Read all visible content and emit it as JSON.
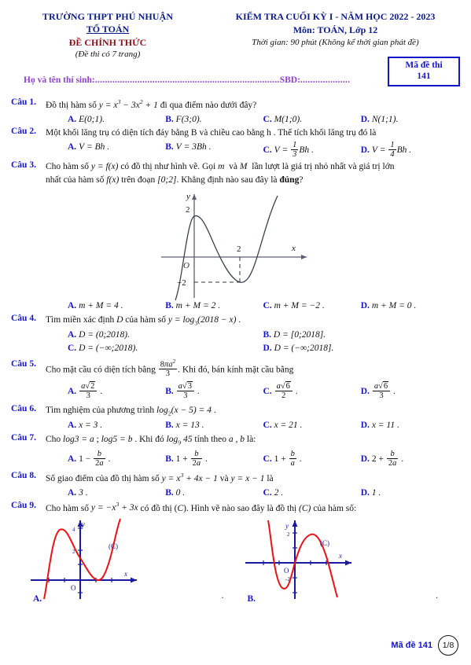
{
  "header": {
    "school": "TRƯỜNG THPT PHÚ NHUẬN",
    "dept": "TỔ TOÁN",
    "official": "ĐỀ CHÍNH THỨC",
    "pages_note": "(Đề thi có 7 trang)",
    "exam_title": "KIỂM TRA CUỐI KỲ I - NĂM HỌC 2022 - 2023",
    "subject": "Môn: TOÁN, Lớp 12",
    "duration": "Thời gian: 90 phút (Không kể thời gian phát đề)",
    "code_label": "Mã đề thi",
    "code_value": "141",
    "name_label": "Họ và tên thí sinh:",
    "name_dots": "..........................................................................",
    "sbd_label": "SBD:",
    "sbd_dots": "...................."
  },
  "questions": [
    {
      "label": "Câu 1.",
      "stem_pre": "Đồ thị hàm số ",
      "stem_post": " đi qua điểm nào dưới đây?",
      "options": [
        {
          "letter": "A.",
          "text": "E(0;1)."
        },
        {
          "letter": "B.",
          "text": "F(3;0)."
        },
        {
          "letter": "C.",
          "text": "M(1;0)."
        },
        {
          "letter": "D.",
          "text": "N(1;1)."
        }
      ]
    },
    {
      "label": "Câu 2.",
      "stem": "Một khối lăng trụ có diện tích đáy bằng B và chiều cao bằng h . Thể tích khối lăng trụ đó là",
      "options": [
        {
          "letter": "A.",
          "text": "V = Bh ."
        },
        {
          "letter": "B.",
          "text": "V = 3Bh ."
        },
        {
          "letter": "C.",
          "text": "V = 1/3 Bh ."
        },
        {
          "letter": "D.",
          "text": "V = 1/4 Bh ."
        }
      ]
    },
    {
      "label": "Câu 3.",
      "stem_line1": "Cho hàm số y = f(x) có đồ thị như hình vẽ. Gọi m và M lần lượt là giá trị nhỏ nhất và giá trị lớn",
      "stem_line2": "nhất của hàm số f(x) trên đoạn [0;2]. Khẳng định nào sau đây là đúng?",
      "bold_word": "đúng",
      "options": [
        {
          "letter": "A.",
          "text": "m + M = 4 ."
        },
        {
          "letter": "B.",
          "text": "m + M = 2 ."
        },
        {
          "letter": "C.",
          "text": "m + M = −2 ."
        },
        {
          "letter": "D.",
          "text": "m + M = 0 ."
        }
      ]
    },
    {
      "label": "Câu 4.",
      "stem": "Tìm miền xác định D của hàm số y = log₃(2018 − x) .",
      "options": [
        {
          "letter": "A.",
          "text": "D = (0;2018)."
        },
        {
          "letter": "B.",
          "text": "D = [0;2018]."
        },
        {
          "letter": "C.",
          "text": "D = (−∞;2018)."
        },
        {
          "letter": "D.",
          "text": "D = (−∞;2018]."
        }
      ]
    },
    {
      "label": "Câu 5.",
      "stem_pre": "Cho mặt cầu có diện tích bằng ",
      "stem_post": ". Khi đó, bán kính mặt cầu bằng",
      "options": [
        {
          "letter": "A.",
          "text": "a√2 / 3 ."
        },
        {
          "letter": "B.",
          "text": "a√3 / 3 ."
        },
        {
          "letter": "C.",
          "text": "a√6 / 2 ."
        },
        {
          "letter": "D.",
          "text": "a√6 / 3 ."
        }
      ]
    },
    {
      "label": "Câu 6.",
      "stem": "Tìm nghiệm của phương trình log₂(x − 5) = 4 .",
      "options": [
        {
          "letter": "A.",
          "text": "x = 3 ."
        },
        {
          "letter": "B.",
          "text": "x = 13 ."
        },
        {
          "letter": "C.",
          "text": "x = 21 ."
        },
        {
          "letter": "D.",
          "text": "x = 11 ."
        }
      ]
    },
    {
      "label": "Câu 7.",
      "stem": "Cho log3 = a ; log5 = b . Khi đó log₉ 45 tính theo a , b là:",
      "options": [
        {
          "letter": "A.",
          "text": "1 − b/(2a) ."
        },
        {
          "letter": "B.",
          "text": "1 + b/(2a) ."
        },
        {
          "letter": "C.",
          "text": "1 + b/a ."
        },
        {
          "letter": "D.",
          "text": "2 + b/(2a) ."
        }
      ]
    },
    {
      "label": "Câu 8.",
      "stem": "Số giao điểm của đồ thị hàm số y = x³ + 4x − 1 và y = x − 1 là",
      "options": [
        {
          "letter": "A.",
          "text": "3 ."
        },
        {
          "letter": "B.",
          "text": "0 ."
        },
        {
          "letter": "C.",
          "text": "2 ."
        },
        {
          "letter": "D.",
          "text": "1 ."
        }
      ]
    },
    {
      "label": "Câu 9.",
      "stem": "Cho hàm số y = −x³ + 3x có đồ thị (C). Hình vẽ nào sao đây là đồ thị (C) của hàm số:",
      "options": [
        {
          "letter": "A.",
          "text": "."
        },
        {
          "letter": "B.",
          "text": "."
        }
      ]
    }
  ],
  "figure_q3": {
    "axis_label_y": "y",
    "axis_label_x": "x",
    "origin_label": "O",
    "tick_y_top": "2",
    "tick_y_bottom": "−2",
    "tick_x": "2",
    "description": "cubic curve with local maximum at y=2 near x=0 and local minimum at (2,-2)"
  },
  "figure_q9": {
    "curve_label": "(C)",
    "axis_label_x": "x",
    "axis_label_y": "y",
    "origin_label": "O",
    "option_a": {
      "tick_top": "4",
      "tick_mid": "2"
    },
    "option_b": {
      "tick_top": "2",
      "tick_bottom": "-2"
    }
  },
  "footer": {
    "code_text": "Mã đề 141",
    "page_text": "1/8"
  },
  "colors": {
    "blue": "#1414c8",
    "dark_blue": "#0a1b8c",
    "maroon": "#8a0f17",
    "purple": "#8d3fd0",
    "red_curve": "#ee1111",
    "axis_blue": "#1a1a9e"
  }
}
